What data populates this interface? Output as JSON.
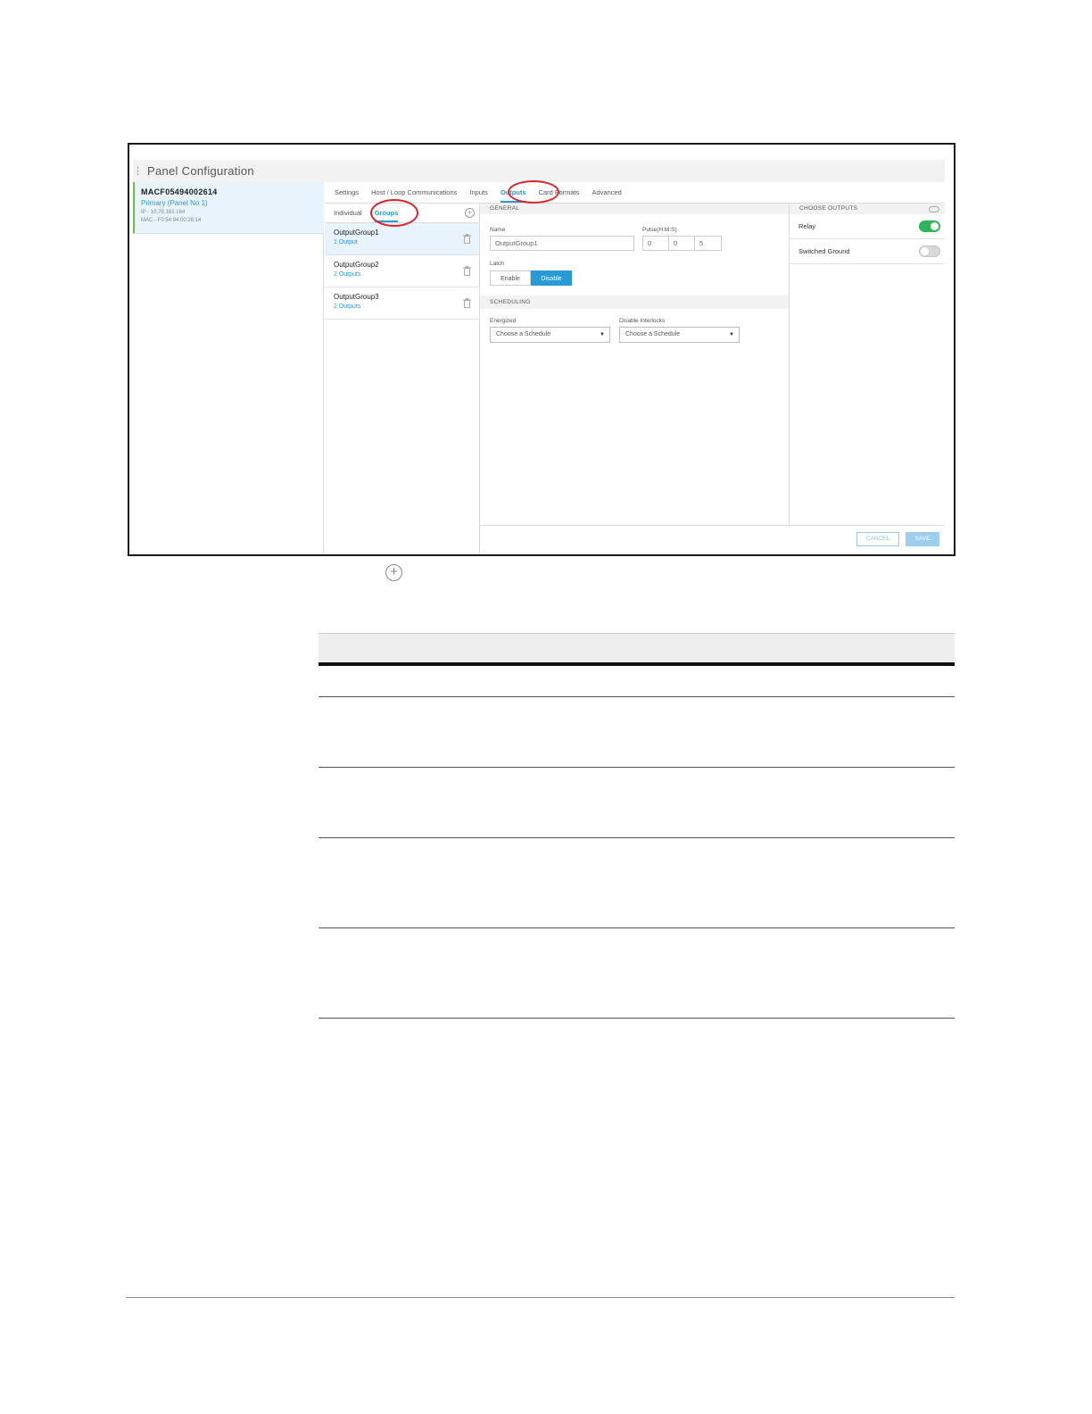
{
  "app": {
    "title": "Panel Configuration"
  },
  "panel": {
    "name": "MACF05494002614",
    "role": "Primary (Panel No 1)",
    "ip": "IP - 10.78.162.164",
    "mac": "MAC - F0:54:94:00:26:14"
  },
  "main_tabs": [
    "Settings",
    "Host / Loop Communications",
    "Inputs",
    "Outputs",
    "Card Formats",
    "Advanced"
  ],
  "active_main_tab": "Outputs",
  "sub_tabs": [
    "Individual",
    "Groups"
  ],
  "groups": [
    {
      "name": "OutputGroup1",
      "count": "1 Output"
    },
    {
      "name": "OutputGroup2",
      "count": "2 Outputs"
    },
    {
      "name": "OutputGroup3",
      "count": "2 Outputs"
    }
  ],
  "general": {
    "heading": "GENERAL",
    "name_label": "Name",
    "name_value": "OutputGroup1",
    "pulse_label": "Pulse(H:M:S)",
    "pulse_h": "0",
    "pulse_m": "0",
    "pulse_s": "5",
    "latch_label": "Latch",
    "latch_enable": "Enable",
    "latch_disable": "Disable"
  },
  "scheduling": {
    "heading": "SCHEDULING",
    "energized_label": "Energized",
    "energized_value": "Choose a Schedule",
    "interlocks_label": "Disable Interlocks",
    "interlocks_value": "Choose a Schedule"
  },
  "outputs": {
    "heading": "CHOOSE OUTPUTS",
    "items": [
      {
        "label": "Relay",
        "on": true
      },
      {
        "label": "Switched Ground",
        "on": false
      }
    ]
  },
  "footer": {
    "cancel": "CANCEL",
    "save": "SAVE"
  },
  "colors": {
    "accent": "#2a9ad6",
    "toggle_on": "#2fb45a",
    "annotation": "#d9262b"
  }
}
